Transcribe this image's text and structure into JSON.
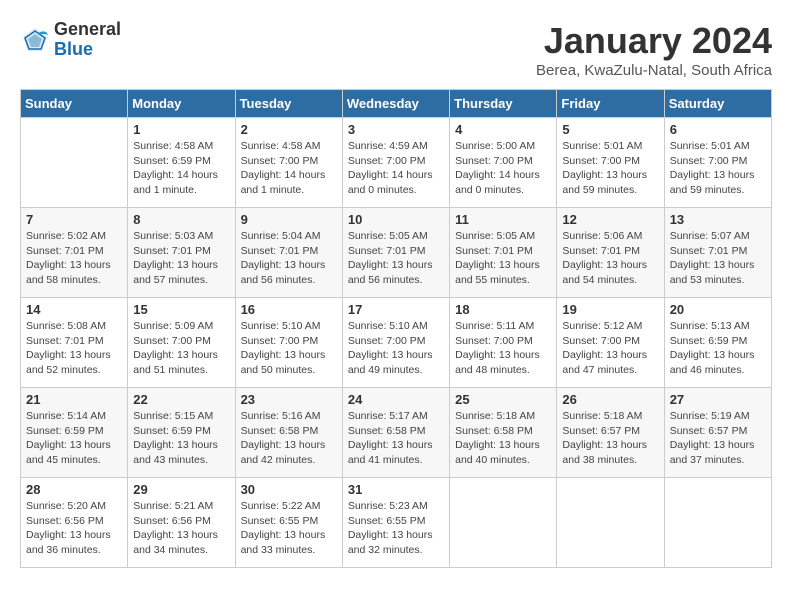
{
  "header": {
    "logo_general": "General",
    "logo_blue": "Blue",
    "month_title": "January 2024",
    "subtitle": "Berea, KwaZulu-Natal, South Africa"
  },
  "days_of_week": [
    "Sunday",
    "Monday",
    "Tuesday",
    "Wednesday",
    "Thursday",
    "Friday",
    "Saturday"
  ],
  "weeks": [
    [
      {
        "day": "",
        "info": ""
      },
      {
        "day": "1",
        "info": "Sunrise: 4:58 AM\nSunset: 6:59 PM\nDaylight: 14 hours\nand 1 minute."
      },
      {
        "day": "2",
        "info": "Sunrise: 4:58 AM\nSunset: 7:00 PM\nDaylight: 14 hours\nand 1 minute."
      },
      {
        "day": "3",
        "info": "Sunrise: 4:59 AM\nSunset: 7:00 PM\nDaylight: 14 hours\nand 0 minutes."
      },
      {
        "day": "4",
        "info": "Sunrise: 5:00 AM\nSunset: 7:00 PM\nDaylight: 14 hours\nand 0 minutes."
      },
      {
        "day": "5",
        "info": "Sunrise: 5:01 AM\nSunset: 7:00 PM\nDaylight: 13 hours\nand 59 minutes."
      },
      {
        "day": "6",
        "info": "Sunrise: 5:01 AM\nSunset: 7:00 PM\nDaylight: 13 hours\nand 59 minutes."
      }
    ],
    [
      {
        "day": "7",
        "info": "Sunrise: 5:02 AM\nSunset: 7:01 PM\nDaylight: 13 hours\nand 58 minutes."
      },
      {
        "day": "8",
        "info": "Sunrise: 5:03 AM\nSunset: 7:01 PM\nDaylight: 13 hours\nand 57 minutes."
      },
      {
        "day": "9",
        "info": "Sunrise: 5:04 AM\nSunset: 7:01 PM\nDaylight: 13 hours\nand 56 minutes."
      },
      {
        "day": "10",
        "info": "Sunrise: 5:05 AM\nSunset: 7:01 PM\nDaylight: 13 hours\nand 56 minutes."
      },
      {
        "day": "11",
        "info": "Sunrise: 5:05 AM\nSunset: 7:01 PM\nDaylight: 13 hours\nand 55 minutes."
      },
      {
        "day": "12",
        "info": "Sunrise: 5:06 AM\nSunset: 7:01 PM\nDaylight: 13 hours\nand 54 minutes."
      },
      {
        "day": "13",
        "info": "Sunrise: 5:07 AM\nSunset: 7:01 PM\nDaylight: 13 hours\nand 53 minutes."
      }
    ],
    [
      {
        "day": "14",
        "info": "Sunrise: 5:08 AM\nSunset: 7:01 PM\nDaylight: 13 hours\nand 52 minutes."
      },
      {
        "day": "15",
        "info": "Sunrise: 5:09 AM\nSunset: 7:00 PM\nDaylight: 13 hours\nand 51 minutes."
      },
      {
        "day": "16",
        "info": "Sunrise: 5:10 AM\nSunset: 7:00 PM\nDaylight: 13 hours\nand 50 minutes."
      },
      {
        "day": "17",
        "info": "Sunrise: 5:10 AM\nSunset: 7:00 PM\nDaylight: 13 hours\nand 49 minutes."
      },
      {
        "day": "18",
        "info": "Sunrise: 5:11 AM\nSunset: 7:00 PM\nDaylight: 13 hours\nand 48 minutes."
      },
      {
        "day": "19",
        "info": "Sunrise: 5:12 AM\nSunset: 7:00 PM\nDaylight: 13 hours\nand 47 minutes."
      },
      {
        "day": "20",
        "info": "Sunrise: 5:13 AM\nSunset: 6:59 PM\nDaylight: 13 hours\nand 46 minutes."
      }
    ],
    [
      {
        "day": "21",
        "info": "Sunrise: 5:14 AM\nSunset: 6:59 PM\nDaylight: 13 hours\nand 45 minutes."
      },
      {
        "day": "22",
        "info": "Sunrise: 5:15 AM\nSunset: 6:59 PM\nDaylight: 13 hours\nand 43 minutes."
      },
      {
        "day": "23",
        "info": "Sunrise: 5:16 AM\nSunset: 6:58 PM\nDaylight: 13 hours\nand 42 minutes."
      },
      {
        "day": "24",
        "info": "Sunrise: 5:17 AM\nSunset: 6:58 PM\nDaylight: 13 hours\nand 41 minutes."
      },
      {
        "day": "25",
        "info": "Sunrise: 5:18 AM\nSunset: 6:58 PM\nDaylight: 13 hours\nand 40 minutes."
      },
      {
        "day": "26",
        "info": "Sunrise: 5:18 AM\nSunset: 6:57 PM\nDaylight: 13 hours\nand 38 minutes."
      },
      {
        "day": "27",
        "info": "Sunrise: 5:19 AM\nSunset: 6:57 PM\nDaylight: 13 hours\nand 37 minutes."
      }
    ],
    [
      {
        "day": "28",
        "info": "Sunrise: 5:20 AM\nSunset: 6:56 PM\nDaylight: 13 hours\nand 36 minutes."
      },
      {
        "day": "29",
        "info": "Sunrise: 5:21 AM\nSunset: 6:56 PM\nDaylight: 13 hours\nand 34 minutes."
      },
      {
        "day": "30",
        "info": "Sunrise: 5:22 AM\nSunset: 6:55 PM\nDaylight: 13 hours\nand 33 minutes."
      },
      {
        "day": "31",
        "info": "Sunrise: 5:23 AM\nSunset: 6:55 PM\nDaylight: 13 hours\nand 32 minutes."
      },
      {
        "day": "",
        "info": ""
      },
      {
        "day": "",
        "info": ""
      },
      {
        "day": "",
        "info": ""
      }
    ]
  ]
}
